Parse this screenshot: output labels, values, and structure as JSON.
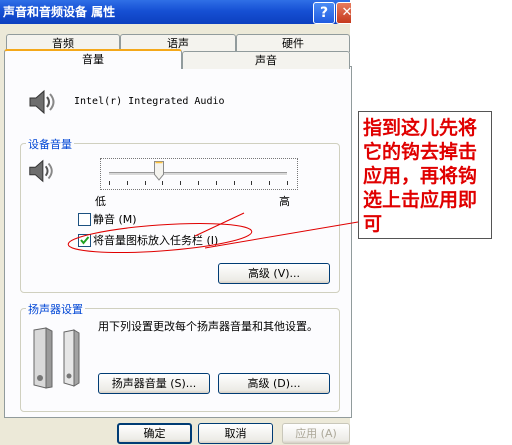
{
  "window": {
    "title": "声音和音频设备 属性"
  },
  "tabs_back": [
    "音频",
    "语声",
    "硬件"
  ],
  "tabs_front": [
    "音量",
    "声音"
  ],
  "device": {
    "name": "Intel(r) Integrated Audio"
  },
  "device_volume": {
    "label": "设备音量",
    "slider_level_percent": 28,
    "low_label": "低",
    "high_label": "高",
    "mute_label": "静音 (M)",
    "mute_checked": false,
    "tray_label": "将音量图标放入任务栏 (I)",
    "tray_checked": true,
    "advanced_label": "高级 (V)..."
  },
  "speaker": {
    "label": "扬声器设置",
    "description": "用下列设置更改每个扬声器音量和其他设置。",
    "volume_button": "扬声器音量 (S)...",
    "advanced_button": "高级 (D)..."
  },
  "footer": {
    "ok": "确定",
    "cancel": "取消",
    "apply": "应用 (A)"
  },
  "annotation": {
    "text": "指到这儿先将它的钩去掉击应用，再将钩选上击应用即可",
    "color": "#e00000"
  }
}
